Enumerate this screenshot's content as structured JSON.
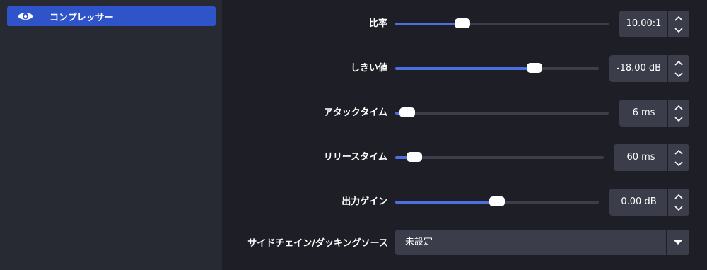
{
  "filters": {
    "items": [
      {
        "label": "コンプレッサー",
        "icon": "eye-icon"
      }
    ]
  },
  "controls": {
    "ratio": {
      "label": "比率",
      "value": "10.00:1",
      "level": 0.3
    },
    "threshold": {
      "label": "しきい値",
      "value": "-18.00 dB",
      "level": 0.7
    },
    "attack": {
      "label": "アタックタイム",
      "value": "6 ms",
      "level": 0.02
    },
    "release": {
      "label": "リリースタイム",
      "value": "60 ms",
      "level": 0.06
    },
    "output_gain": {
      "label": "出力ゲイン",
      "value": "0.00 dB",
      "level": 0.5
    },
    "sidechain": {
      "label": "サイドチェイン/ダッキングソース",
      "value": "未設定"
    }
  },
  "colors": {
    "accent": "#2f54c9",
    "slider_fill": "#4d6fe0",
    "background": "#1e1f26",
    "panel": "#272a33"
  }
}
